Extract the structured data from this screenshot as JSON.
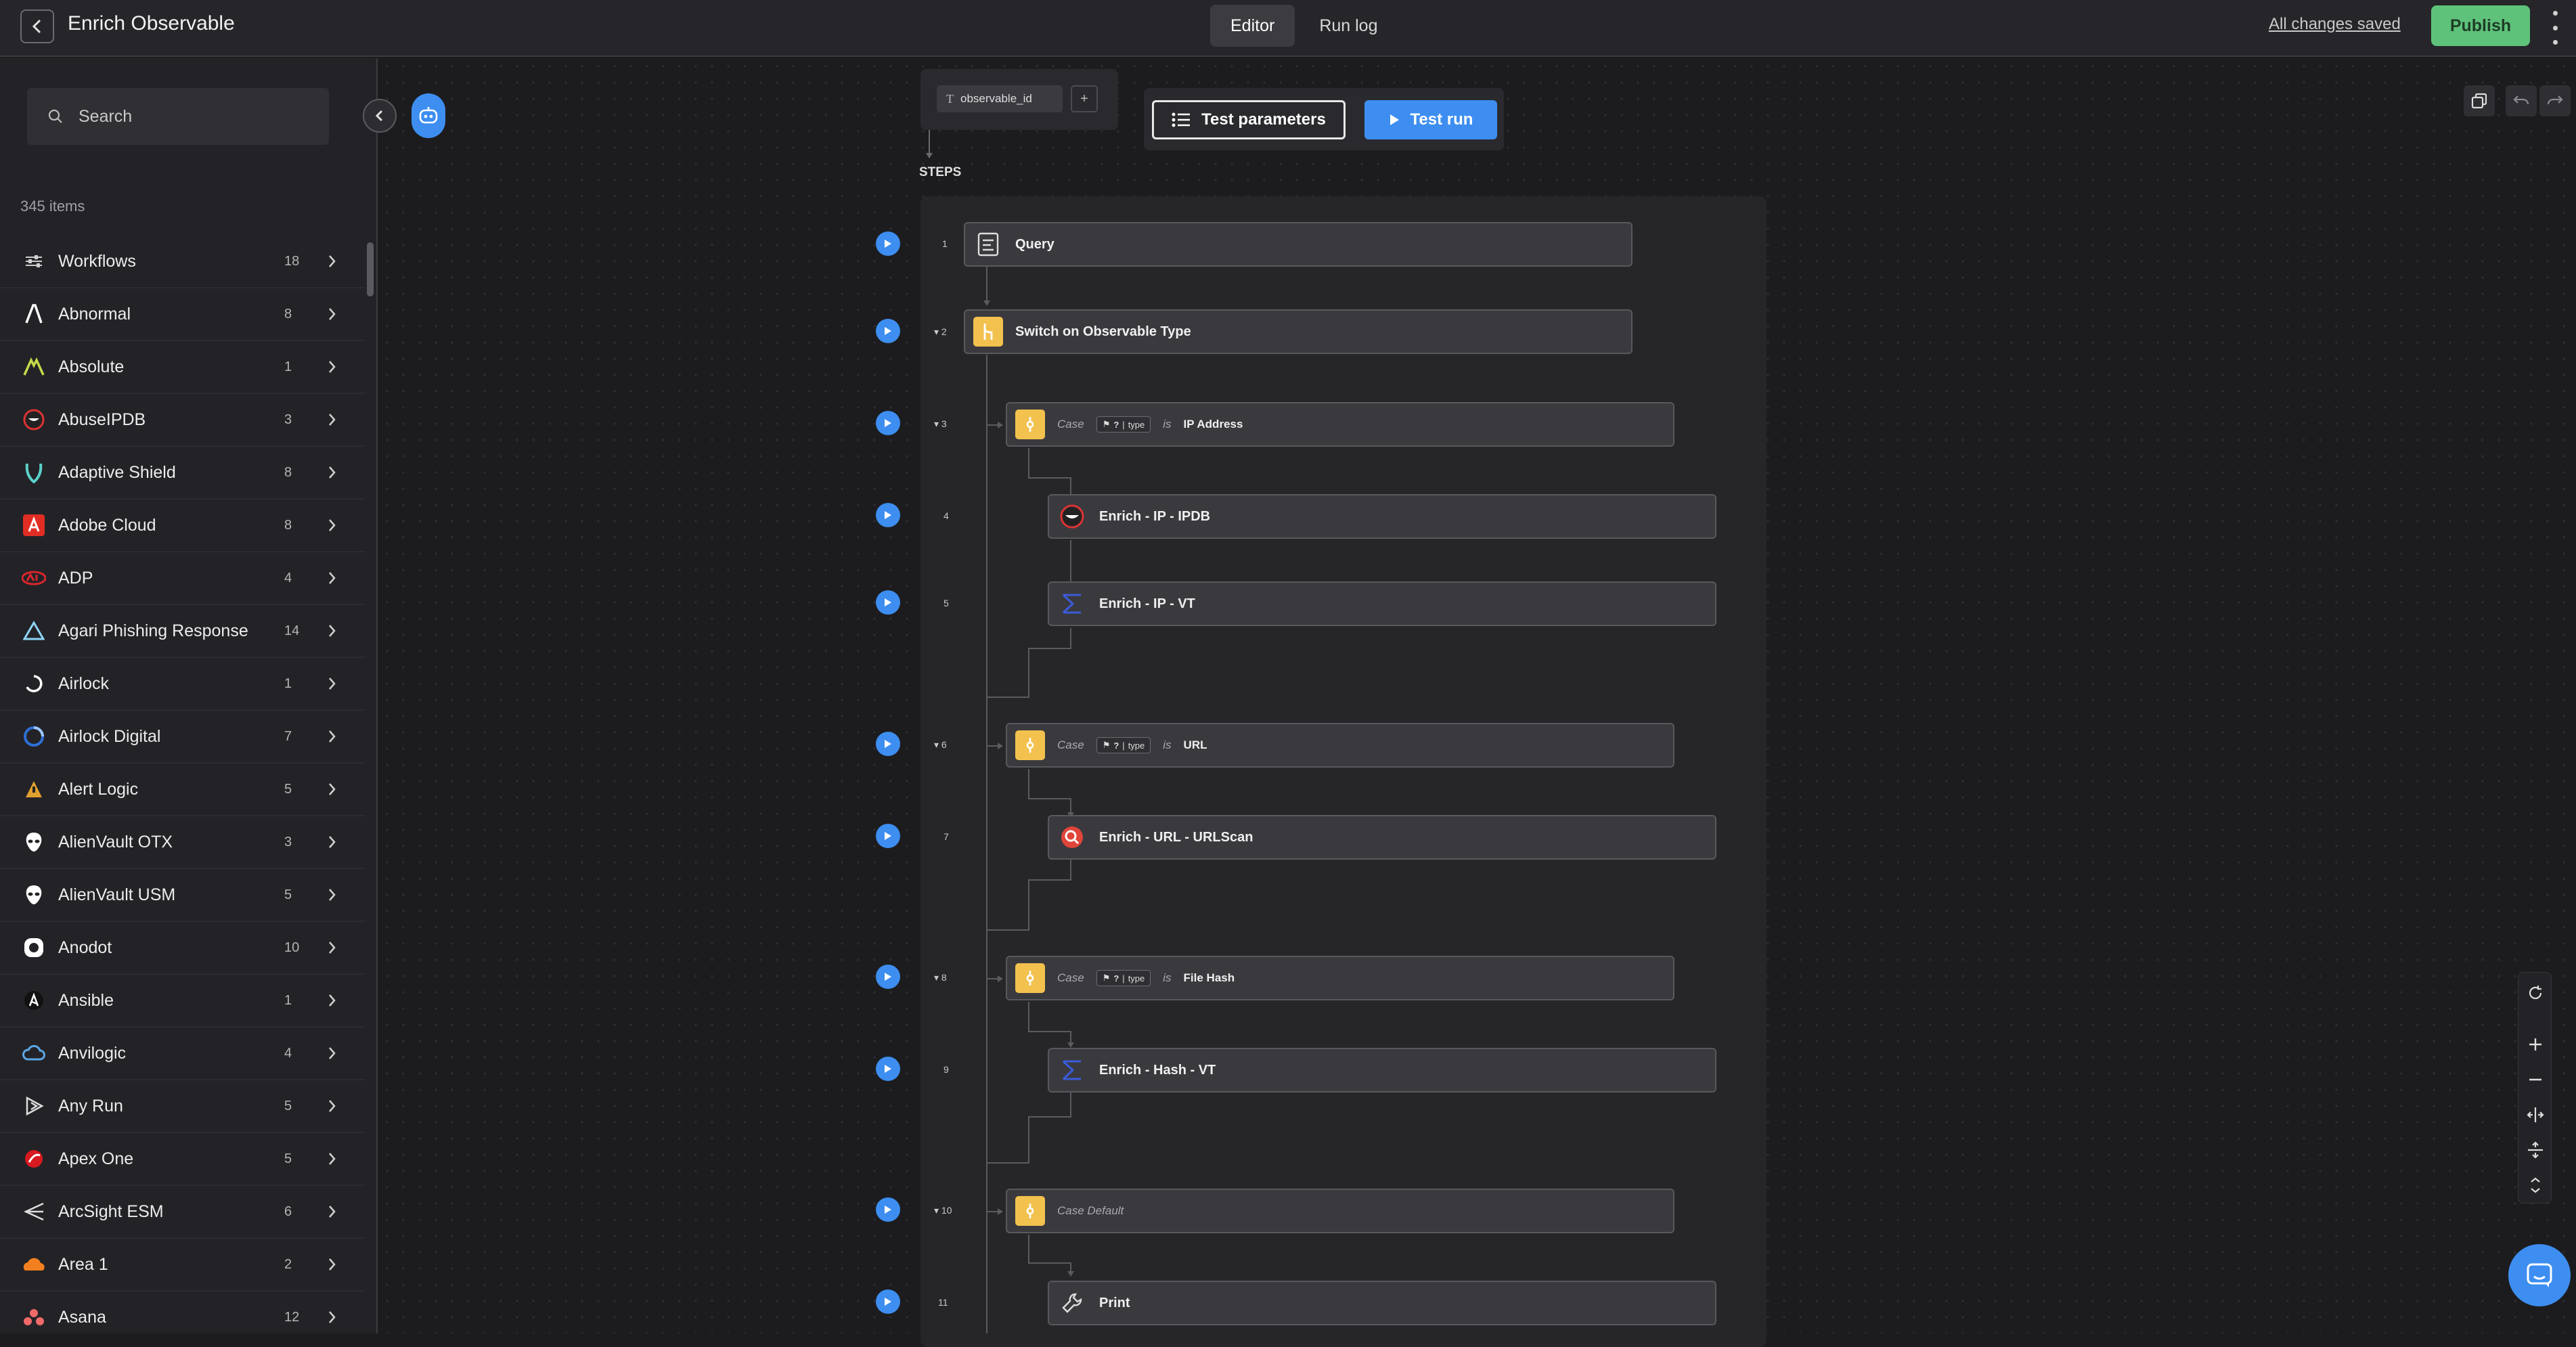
{
  "header": {
    "title": "Enrich Observable",
    "tabs": [
      {
        "label": "Editor"
      },
      {
        "label": "Run log"
      }
    ],
    "saved_text": "All changes saved",
    "publish_label": "Publish"
  },
  "sidebar": {
    "search_placeholder": "Search",
    "count_label": "345 items",
    "items": [
      {
        "label": "Workflows",
        "count": "18",
        "icon": "sliders-icon"
      },
      {
        "label": "Abnormal",
        "count": "8",
        "icon": "abnormal-logo"
      },
      {
        "label": "Absolute",
        "count": "1",
        "icon": "absolute-logo"
      },
      {
        "label": "AbuseIPDB",
        "count": "3",
        "icon": "abuseipdb-logo"
      },
      {
        "label": "Adaptive Shield",
        "count": "8",
        "icon": "shield-logo"
      },
      {
        "label": "Adobe Cloud",
        "count": "8",
        "icon": "adobe-logo"
      },
      {
        "label": "ADP",
        "count": "4",
        "icon": "adp-logo"
      },
      {
        "label": "Agari Phishing Response",
        "count": "14",
        "icon": "agari-logo"
      },
      {
        "label": "Airlock",
        "count": "1",
        "icon": "airlock-logo"
      },
      {
        "label": "Airlock Digital",
        "count": "7",
        "icon": "airlock-digital-logo"
      },
      {
        "label": "Alert Logic",
        "count": "5",
        "icon": "alert-logic-logo"
      },
      {
        "label": "AlienVault OTX",
        "count": "3",
        "icon": "alien-logo"
      },
      {
        "label": "AlienVault USM",
        "count": "5",
        "icon": "alien-logo"
      },
      {
        "label": "Anodot",
        "count": "10",
        "icon": "anodot-logo"
      },
      {
        "label": "Ansible",
        "count": "1",
        "icon": "ansible-logo"
      },
      {
        "label": "Anvilogic",
        "count": "4",
        "icon": "cloud-logo"
      },
      {
        "label": "Any Run",
        "count": "5",
        "icon": "anyrun-logo"
      },
      {
        "label": "Apex One",
        "count": "5",
        "icon": "apex-logo"
      },
      {
        "label": "ArcSight ESM",
        "count": "6",
        "icon": "arcsight-logo"
      },
      {
        "label": "Area 1",
        "count": "2",
        "icon": "cloudflare-logo"
      },
      {
        "label": "Asana",
        "count": "12",
        "icon": "asana-logo"
      }
    ]
  },
  "canvas": {
    "input_param": "observable_id",
    "add_param_label": "+",
    "test_params_label": "Test parameters",
    "test_run_label": "Test run",
    "steps_label": "STEPS",
    "steps": [
      {
        "num": "1",
        "label": "Query"
      },
      {
        "num": "2",
        "label": "Switch on Observable Type"
      },
      {
        "num": "3",
        "case_word": "Case",
        "chip": "type",
        "is_word": "is",
        "value": "IP Address"
      },
      {
        "num": "4",
        "label": "Enrich - IP - IPDB"
      },
      {
        "num": "5",
        "label": "Enrich - IP - VT"
      },
      {
        "num": "6",
        "case_word": "Case",
        "chip": "type",
        "is_word": "is",
        "value": "URL"
      },
      {
        "num": "7",
        "label": "Enrich - URL - URLScan"
      },
      {
        "num": "8",
        "case_word": "Case",
        "chip": "type",
        "is_word": "is",
        "value": "File Hash"
      },
      {
        "num": "9",
        "label": "Enrich - Hash - VT"
      },
      {
        "num": "10",
        "case_word": "Case Default"
      },
      {
        "num": "11",
        "label": "Print"
      }
    ]
  },
  "colors": {
    "accent_blue": "#3d8ef0",
    "publish_green": "#5ec27a",
    "case_yellow": "#f2c14e"
  }
}
